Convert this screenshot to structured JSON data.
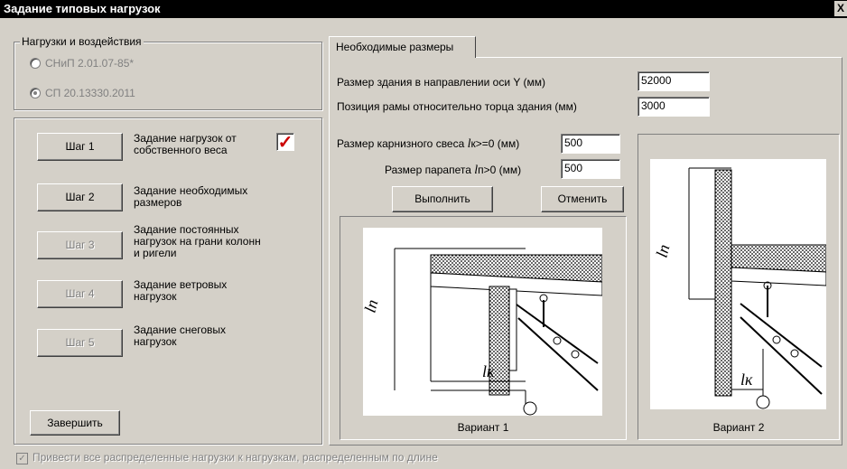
{
  "window": {
    "title": "Задание типовых нагрузок",
    "close_label": "X"
  },
  "loads_group": {
    "legend": "Нагрузки и воздействия",
    "options": [
      {
        "label": "СНиП 2.01.07-85*",
        "selected": false
      },
      {
        "label": "СП 20.13330.2011",
        "selected": true
      }
    ]
  },
  "steps": [
    {
      "button": "Шаг 1",
      "text": "Задание нагрузок от собственного веса",
      "enabled": true,
      "checked": true
    },
    {
      "button": "Шаг 2",
      "text": "Задание необходимых размеров",
      "enabled": true
    },
    {
      "button": "Шаг 3",
      "text": "Задание постоянных нагрузок на грани колонн и ригели",
      "enabled": false
    },
    {
      "button": "Шаг 4",
      "text": "Задание ветровых нагрузок",
      "enabled": false
    },
    {
      "button": "Шаг 5",
      "text": "Задание снеговых нагрузок",
      "enabled": false
    }
  ],
  "finish_button": "Завершить",
  "bottom_checkbox": {
    "label": "Привести все распределенные нагрузки к нагрузкам, распределенным по длине",
    "checked": true
  },
  "tab": {
    "label": "Необходимые размеры"
  },
  "fields": {
    "building_size": {
      "label": "Размер здания в направлении оси Y (мм)",
      "value": "52000"
    },
    "frame_position": {
      "label": "Позиция рамы относительно торца здания (мм)",
      "value": "3000"
    },
    "eave": {
      "label_prefix": "Размер карнизного свеса",
      "symbol": "l",
      "suffix": "к>=0 (мм)",
      "value": "500"
    },
    "parapet": {
      "label_prefix": "Размер парапета",
      "symbol": "l",
      "suffix": "п>0 (мм)",
      "value": "500"
    }
  },
  "actions": {
    "execute": "Выполнить",
    "cancel": "Отменить"
  },
  "variants": [
    {
      "caption": "Вариант 1",
      "label_n": "lп",
      "label_k": "lк"
    },
    {
      "caption": "Вариант 2",
      "label_n": "lп",
      "label_k": "lк"
    }
  ]
}
